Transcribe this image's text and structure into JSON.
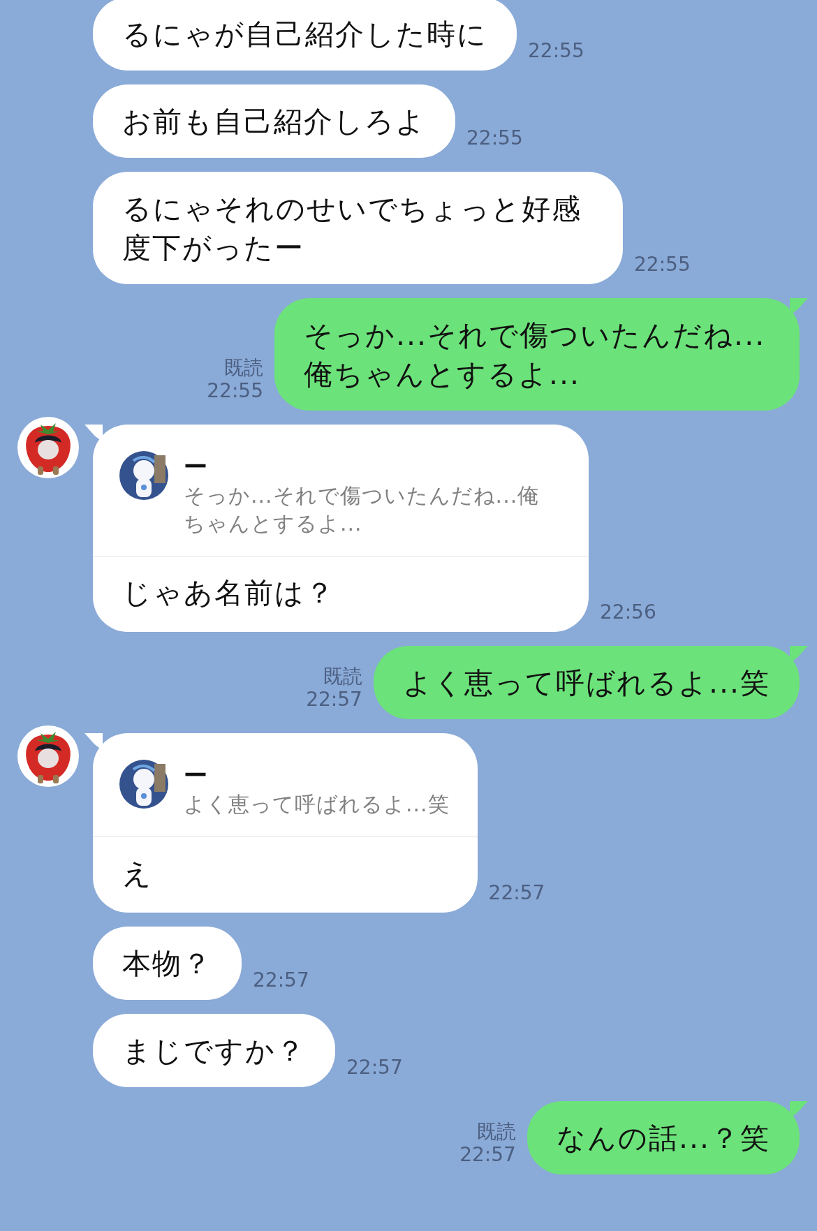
{
  "messages": [
    {
      "kind": "incoming",
      "show_avatar": false,
      "text": "るにゃが自己紹介した時に",
      "time": "22:55"
    },
    {
      "kind": "incoming",
      "show_avatar": false,
      "text": "お前も自己紹介しろよ",
      "time": "22:55"
    },
    {
      "kind": "incoming",
      "show_avatar": false,
      "text": "るにゃそれのせいでちょっと好感度下がったー",
      "time": "22:55"
    },
    {
      "kind": "outgoing",
      "read": "既読",
      "text": "そっか...それで傷ついたんだね...俺ちゃんとするよ...",
      "time": "22:55"
    },
    {
      "kind": "incoming",
      "show_avatar": true,
      "reply": {
        "name": "ー",
        "text": "そっか...それで傷ついたんだね...俺ちゃんとするよ..."
      },
      "text": "じゃあ名前は？",
      "time": "22:56"
    },
    {
      "kind": "outgoing",
      "read": "既読",
      "text": "よく恵って呼ばれるよ...笑",
      "time": "22:57"
    },
    {
      "kind": "incoming",
      "show_avatar": true,
      "reply": {
        "name": "ー",
        "text": "よく恵って呼ばれるよ...笑"
      },
      "text": "え",
      "time": "22:57"
    },
    {
      "kind": "incoming",
      "show_avatar": false,
      "text": "本物？",
      "time": "22:57"
    },
    {
      "kind": "incoming",
      "show_avatar": false,
      "text": "まじですか？",
      "time": "22:57"
    },
    {
      "kind": "outgoing",
      "read": "既読",
      "text": "なんの話...？笑",
      "time": "22:57"
    }
  ]
}
